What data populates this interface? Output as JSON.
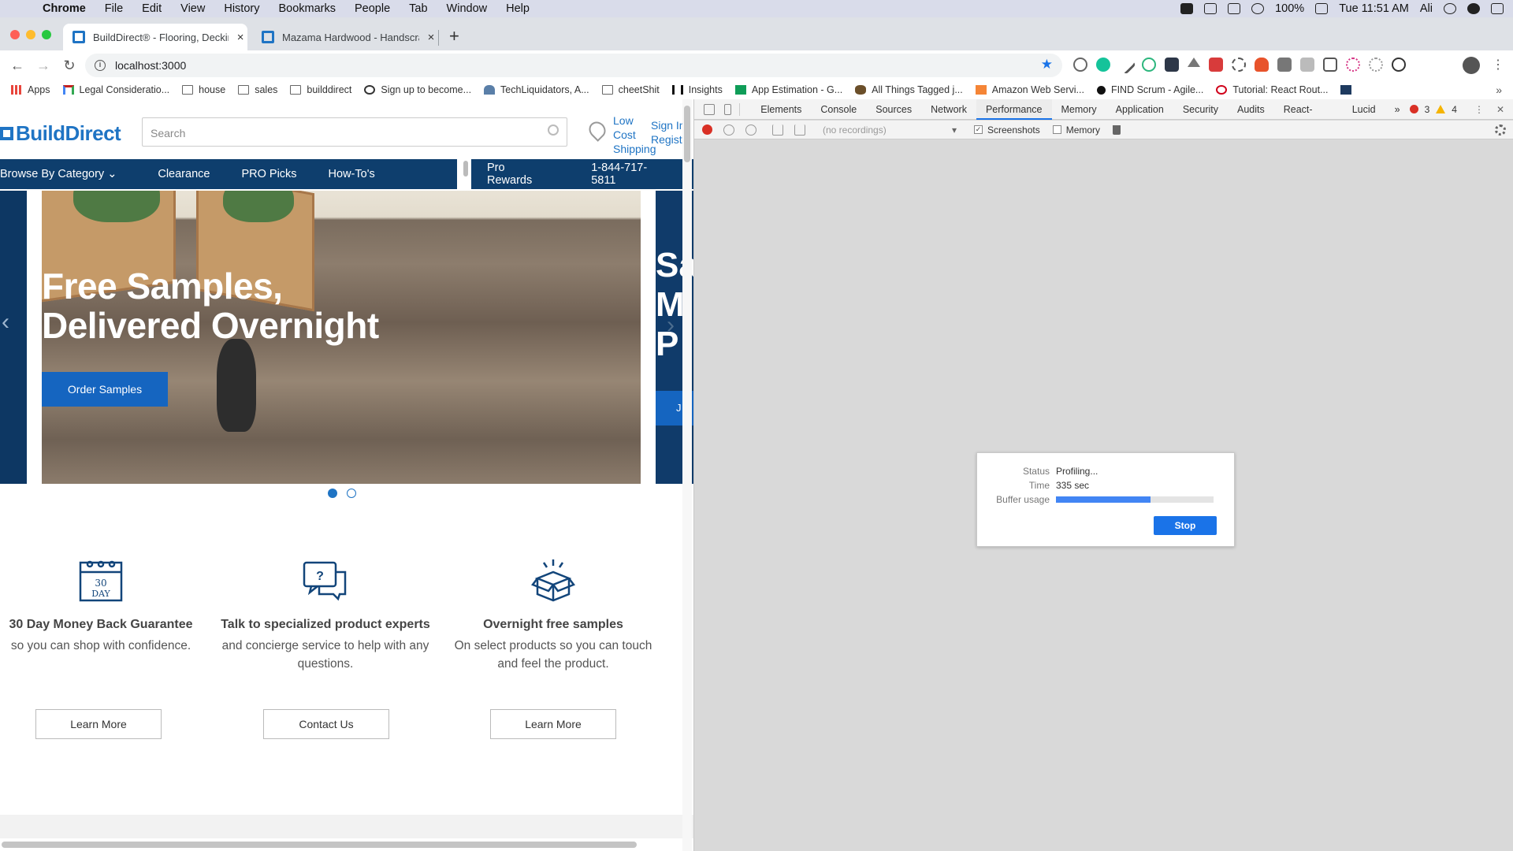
{
  "menubar": {
    "items": [
      "Chrome",
      "File",
      "Edit",
      "View",
      "History",
      "Bookmarks",
      "People",
      "Tab",
      "Window",
      "Help"
    ],
    "battery": "100%",
    "clock": "Tue 11:51 AM",
    "user": "Ali"
  },
  "tabs": [
    {
      "title": "BuildDirect® - Flooring, Decking",
      "active": true
    },
    {
      "title": "Mazama Hardwood - Handscrap",
      "active": false
    }
  ],
  "toolbar": {
    "url": "localhost:3000"
  },
  "bookmarks": [
    {
      "label": "Apps",
      "icon": "apps-grid-icon"
    },
    {
      "label": "Legal Consideratio...",
      "icon": "gmail-icon"
    },
    {
      "label": "house",
      "icon": "folder-icon"
    },
    {
      "label": "sales",
      "icon": "folder-icon"
    },
    {
      "label": "builddirect",
      "icon": "folder-icon"
    },
    {
      "label": "Sign up to become...",
      "icon": "globe-icon"
    },
    {
      "label": "TechLiquidators, A...",
      "icon": "hat-icon"
    },
    {
      "label": "cheetShit",
      "icon": "folder-icon"
    },
    {
      "label": "Insights",
      "icon": "notion-icon"
    },
    {
      "label": "App Estimation - G...",
      "icon": "sheets-icon"
    },
    {
      "label": "All Things Tagged j...",
      "icon": "person-icon"
    },
    {
      "label": "Amazon Web Servi...",
      "icon": "aws-cube-icon"
    },
    {
      "label": "FIND Scrum - Agile...",
      "icon": "dot-icon"
    },
    {
      "label": "Tutorial: React Rout...",
      "icon": "react-router-icon"
    }
  ],
  "site": {
    "logo": "BuildDirect",
    "search_placeholder": "Search",
    "shipping": [
      "Low",
      "Cost",
      "Shipping"
    ],
    "signin": [
      "Sign In",
      "Register"
    ],
    "nav": [
      "Browse By Category",
      "Clearance",
      "PRO Picks",
      "How-To's"
    ],
    "nav_right": [
      "Pro Rewards",
      "1-844-717-5811"
    ],
    "hero": {
      "line1": "Free Samples,",
      "line2": "Delivered Overnight",
      "button": "Order Samples"
    },
    "hero_next": {
      "text": "Sa\nM\nP",
      "button": "J"
    },
    "carousel": {
      "slides": 2,
      "active": 1
    },
    "features": [
      {
        "icon": "calendar-30-day-icon",
        "badge": "30",
        "badge2": "DAY",
        "title": "30 Day Money Back Guarantee",
        "text": "so you can shop with confidence.",
        "button": "Learn More"
      },
      {
        "icon": "chat-question-icon",
        "title": "Talk to specialized product experts",
        "text": "and concierge service to help with any questions.",
        "button": "Contact Us"
      },
      {
        "icon": "open-box-icon",
        "title": "Overnight free samples",
        "text": "On select products so you can touch and feel the product.",
        "button": "Learn More"
      }
    ]
  },
  "devtools": {
    "tabs": [
      "Elements",
      "Console",
      "Sources",
      "Network",
      "Performance",
      "Memory",
      "Application",
      "Security",
      "Audits",
      "React-Sight",
      "Lucid"
    ],
    "active_tab": "Performance",
    "errors": "3",
    "warnings": "4",
    "recordings_placeholder": "(no recordings)",
    "screenshots_label": "Screenshots",
    "screenshots_checked": true,
    "memory_label": "Memory",
    "memory_checked": false,
    "status_label": "Status",
    "status_value": "Profiling...",
    "time_label": "Time",
    "time_value": "335 sec",
    "buffer_label": "Buffer usage",
    "buffer_fraction": 0.6,
    "stop_label": "Stop",
    "accent": "#1a73e8"
  }
}
